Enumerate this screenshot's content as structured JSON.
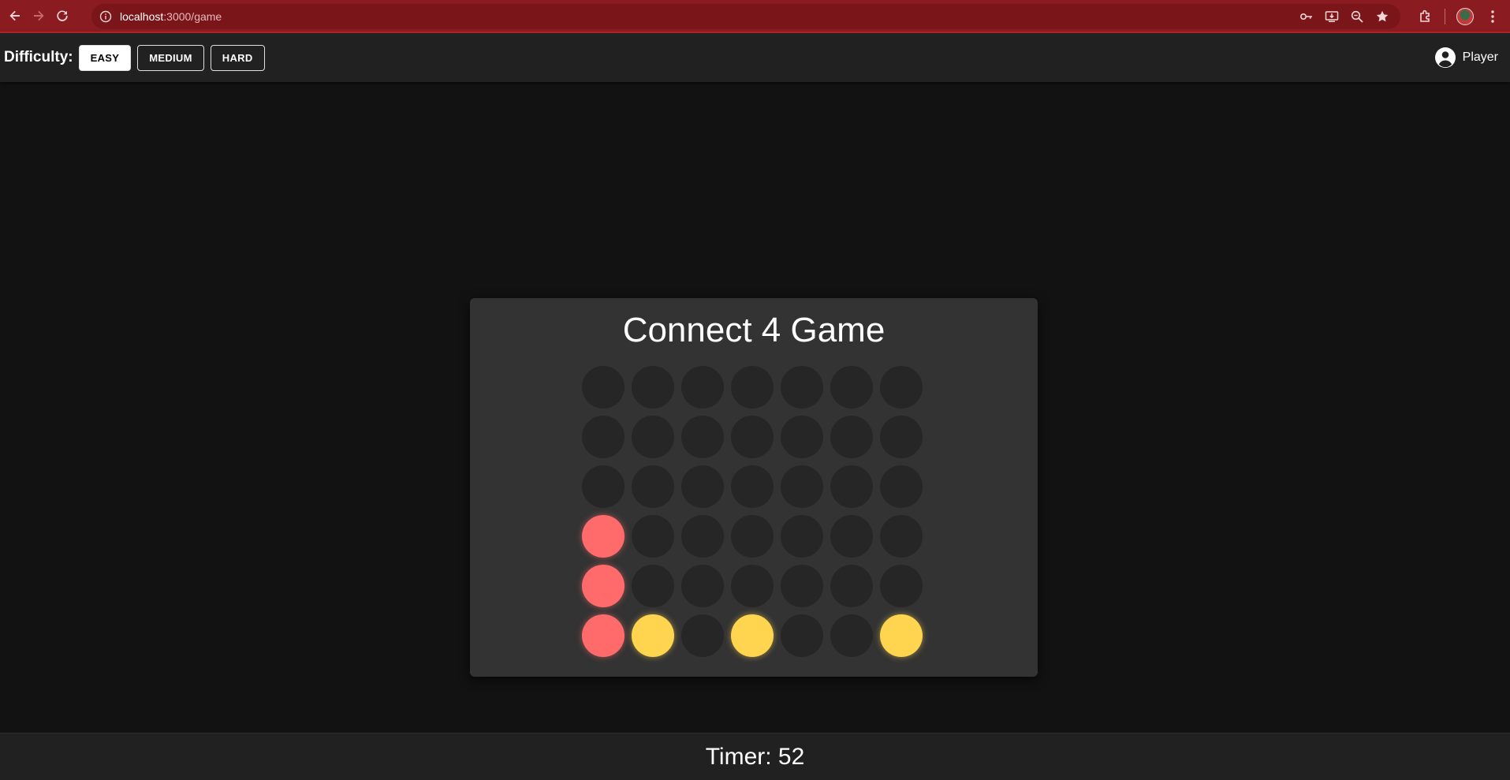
{
  "browser": {
    "url_host": "localhost",
    "url_rest": ":3000/game"
  },
  "header": {
    "difficulty_label": "Difficulty:",
    "buttons": [
      {
        "label": "EASY",
        "active": true
      },
      {
        "label": "MEDIUM",
        "active": false
      },
      {
        "label": "HARD",
        "active": false
      }
    ],
    "player_label": "Player",
    "player_icon": "account-circle-icon"
  },
  "game": {
    "title": "Connect 4 Game",
    "rows": 6,
    "cols": 7,
    "board": [
      [
        "",
        "",
        "",
        "",
        "",
        "",
        ""
      ],
      [
        "",
        "",
        "",
        "",
        "",
        "",
        ""
      ],
      [
        "",
        "",
        "",
        "",
        "",
        "",
        ""
      ],
      [
        "red",
        "",
        "",
        "",
        "",
        "",
        ""
      ],
      [
        "red",
        "",
        "",
        "",
        "",
        "",
        ""
      ],
      [
        "red",
        "yellow",
        "",
        "yellow",
        "",
        "",
        "yellow"
      ]
    ],
    "colors": {
      "red": "#ff6b6b",
      "yellow": "#ffd54f",
      "empty": "#262626"
    }
  },
  "footer": {
    "timer_text": "Timer: 52"
  }
}
